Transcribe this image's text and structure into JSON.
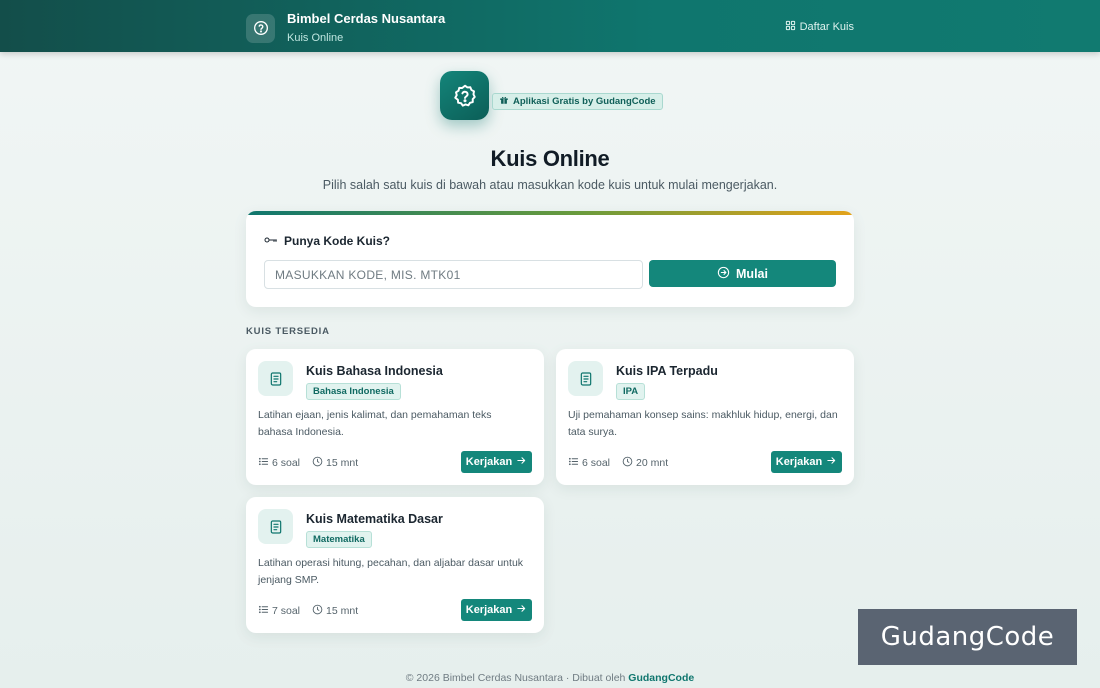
{
  "header": {
    "title": "Bimbel Cerdas Nusantara",
    "subtitle": "Kuis Online",
    "nav_link": "Daftar Kuis"
  },
  "hero": {
    "badge": "Aplikasi Gratis by GudangCode",
    "title": "Kuis Online",
    "subtitle": "Pilih salah satu kuis di bawah atau masukkan kode kuis untuk mulai mengerjakan."
  },
  "code_form": {
    "heading": "Punya Kode Kuis?",
    "placeholder": "MASUKKAN KODE, MIS. MTK01",
    "value": "",
    "button": "Mulai"
  },
  "section_label": "KUIS TERSEDIA",
  "quizzes": [
    {
      "title": "Kuis Bahasa Indonesia",
      "tag": "Bahasa Indonesia",
      "description": "Latihan ejaan, jenis kalimat, dan pemahaman teks bahasa Indonesia.",
      "questions": "6 soal",
      "duration": "15 mnt",
      "button": "Kerjakan"
    },
    {
      "title": "Kuis IPA Terpadu",
      "tag": "IPA",
      "description": "Uji pemahaman konsep sains: makhluk hidup, energi, dan tata surya.",
      "questions": "6 soal",
      "duration": "20 mnt",
      "button": "Kerjakan"
    },
    {
      "title": "Kuis Matematika Dasar",
      "tag": "Matematika",
      "description": "Latihan operasi hitung, pecahan, dan aljabar dasar untuk jenjang SMP.",
      "questions": "7 soal",
      "duration": "15 mnt",
      "button": "Kerjakan"
    }
  ],
  "footer": {
    "text": "© 2026 Bimbel Cerdas Nusantara · Dibuat oleh",
    "brand": "GudangCode"
  },
  "watermark": "GudangCode",
  "colors": {
    "header_start": "#134e4a",
    "header_end": "#117a70",
    "accent": "#14877b",
    "tag_bg": "#e1f3ef",
    "stripe_end": "#e3a21a"
  },
  "icons": {
    "brand": "question-badge-icon",
    "nav": "grid-icon",
    "badge": "gift-icon",
    "code_heading": "key-icon",
    "start_button": "arrow-circle-right-icon",
    "quiz": "document-list-icon",
    "questions": "list-icon",
    "duration": "clock-icon",
    "quiz_button": "arrow-right-icon"
  }
}
